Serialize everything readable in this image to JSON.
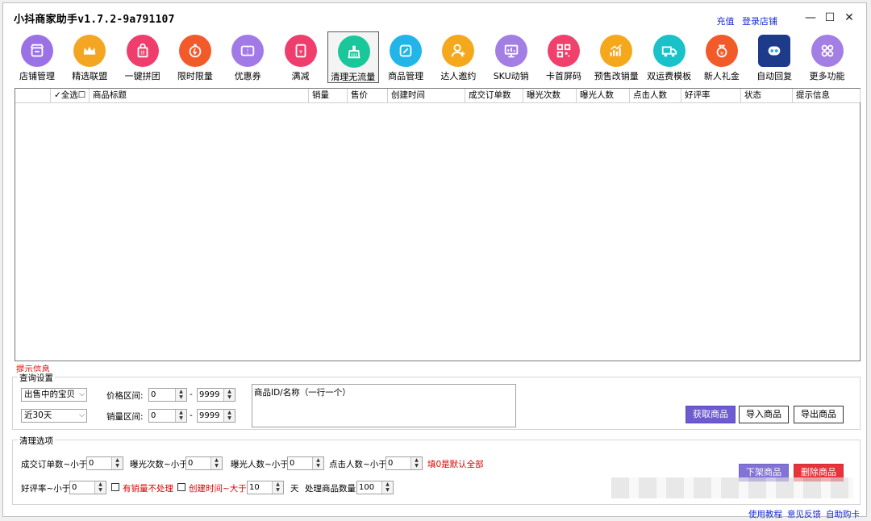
{
  "app": {
    "title": "小抖商家助手v1.7.2-9a791107",
    "links": [
      "充值",
      "登录店铺"
    ],
    "win_controls": {
      "minimize": "—",
      "maximize": "☐",
      "close": "✕"
    }
  },
  "toolbar": [
    {
      "label": "店铺管理",
      "icon": "shop-icon",
      "color": "#9b72e6"
    },
    {
      "label": "精选联盟",
      "icon": "crown-icon",
      "color": "#f4a623"
    },
    {
      "label": "一键拼团",
      "icon": "shopping-bag-icon",
      "color": "#ef3e6d"
    },
    {
      "label": "限时限量",
      "icon": "timer-icon",
      "color": "#f25a2a"
    },
    {
      "label": "优惠券",
      "icon": "coupon-icon",
      "color": "#a17ae8"
    },
    {
      "label": "满减",
      "icon": "red-envelope-icon",
      "color": "#ef3e6d"
    },
    {
      "label": "清理无流量",
      "icon": "broom-icon",
      "color": "#19c79a"
    },
    {
      "label": "商品管理",
      "icon": "edit-icon",
      "color": "#21b5e8"
    },
    {
      "label": "达人邀约",
      "icon": "user-add-icon",
      "color": "#f6a81d"
    },
    {
      "label": "SKU动销",
      "icon": "monitor-icon",
      "color": "#a37ee4"
    },
    {
      "label": "卡首屏码",
      "icon": "qrcode-icon",
      "color": "#f0406b"
    },
    {
      "label": "预售改销量",
      "icon": "chart-up-icon",
      "color": "#f6a81d"
    },
    {
      "label": "双运费模板",
      "icon": "truck-icon",
      "color": "#19c2c9"
    },
    {
      "label": "新人礼金",
      "icon": "money-bag-icon",
      "color": "#f25a2a"
    },
    {
      "label": "自动回复",
      "icon": "robot-icon",
      "color": "#1e3a8a"
    },
    {
      "label": "更多功能",
      "icon": "apps-icon",
      "color": "#a37ee4"
    }
  ],
  "grid": {
    "columns": [
      "",
      "✓全选☐",
      "商品标题",
      "销量",
      "售价",
      "创建时间",
      "成交订单数",
      "曝光次数",
      "曝光人数",
      "点击人数",
      "好评率",
      "状态",
      "提示信息"
    ]
  },
  "hint_label": "提示信息",
  "query": {
    "group_label": "查询设置",
    "status_select": "出售中的宝贝",
    "period_select": "近30天",
    "price_label": "价格区间:",
    "price_min": "0",
    "price_max": "9999",
    "sales_label": "销量区间:",
    "sales_min": "0",
    "sales_max": "9999",
    "dash": "-",
    "ids_placeholder": "商品ID/名称（一行一个）",
    "fetch_button": "获取商品",
    "import_button": "导入商品",
    "export_button": "导出商品"
  },
  "clean": {
    "group_label": "清理选项",
    "orders_label": "成交订单数~小于",
    "orders_value": "0",
    "exposure_label": "曝光次数~小于",
    "exposure_value": "0",
    "viewers_label": "曝光人数~小于",
    "viewers_value": "0",
    "clicks_label": "点击人数~小于",
    "clicks_value": "0",
    "zero_note": "填0是默认全部",
    "rating_label": "好评率~小于",
    "rating_value": "0",
    "skip_sold_label": "有销量不处理",
    "created_label": "创建时间~大于",
    "created_value": "10",
    "days_unit": "天",
    "batch_label": "处理商品数量",
    "batch_value": "100",
    "delist_button": "下架商品",
    "delete_button": "删除商品"
  },
  "footer": [
    "使用教程",
    "意见反馈",
    "自助购卡"
  ]
}
